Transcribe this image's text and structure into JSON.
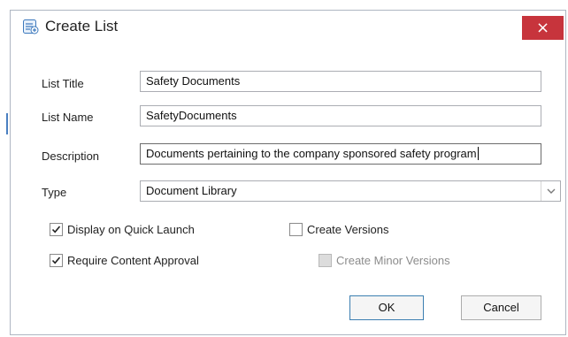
{
  "dialog": {
    "title": "Create List",
    "close_label": "×"
  },
  "fields": {
    "list_title_label": "List Title",
    "list_title_value": "Safety Documents",
    "list_name_label": "List Name",
    "list_name_value": "SafetyDocuments",
    "description_label": "Description",
    "description_value": "Documents pertaining to the company sponsored safety program",
    "type_label": "Type",
    "type_value": "Document Library"
  },
  "options": {
    "display_quick_launch": {
      "label": "Display on Quick Launch",
      "checked": true,
      "enabled": true
    },
    "create_versions": {
      "label": "Create Versions",
      "checked": false,
      "enabled": true
    },
    "require_content_approval": {
      "label": "Require Content Approval",
      "checked": true,
      "enabled": true
    },
    "create_minor_versions": {
      "label": "Create Minor Versions",
      "checked": false,
      "enabled": false
    }
  },
  "buttons": {
    "ok_label": "OK",
    "cancel_label": "Cancel"
  },
  "colors": {
    "close_button": "#c7343c",
    "default_button_border": "#3c7fb1"
  }
}
